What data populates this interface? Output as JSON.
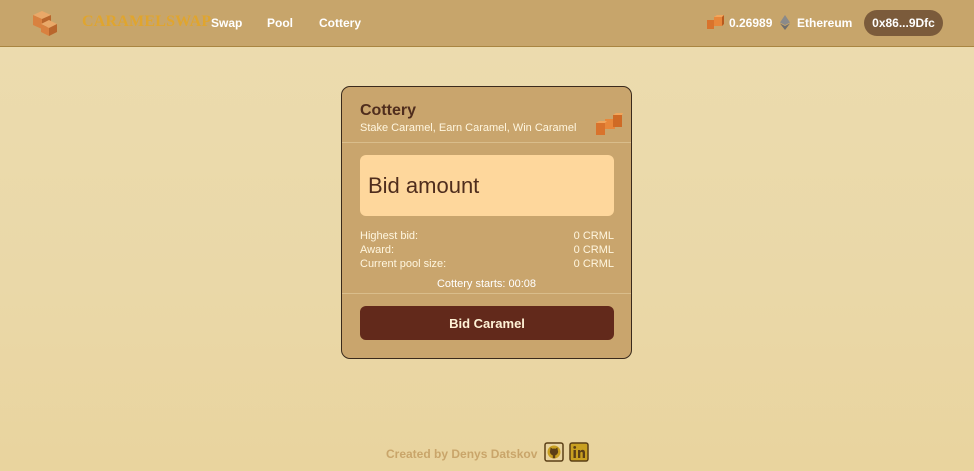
{
  "header": {
    "brand": "CARAMELSWAP",
    "nav": [
      {
        "label": "Swap"
      },
      {
        "label": "Pool"
      },
      {
        "label": "Cottery"
      }
    ],
    "balance": "0.26989",
    "network": "Ethereum",
    "wallet": "0x86...9Dfc"
  },
  "card": {
    "title": "Cottery",
    "subtitle": "Stake Caramel, Earn Caramel, Win Caramel",
    "input_placeholder": "Bid amount",
    "stats": [
      {
        "label": "Highest bid:",
        "value": "0 CRML"
      },
      {
        "label": "Award:",
        "value": "0 CRML"
      },
      {
        "label": "Current pool size:",
        "value": "0 CRML"
      }
    ],
    "countdown": "Cottery starts: 00:08",
    "button": "Bid Caramel"
  },
  "footer": {
    "credit": "Created by Denys Datskov",
    "icons": [
      "github-icon",
      "linkedin-icon"
    ]
  },
  "colors": {
    "header_bg": "#c7a56b",
    "brand": "#e0a52e",
    "card_bg": "#c9a56d",
    "input_bg": "#fed79c",
    "button_bg": "#62291b",
    "wallet_bg": "#7b5b3b",
    "page_bg": "#ecdcaf"
  }
}
